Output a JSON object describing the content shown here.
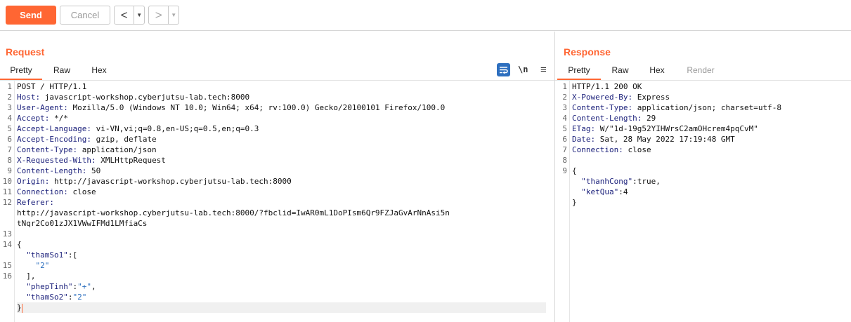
{
  "toolbar": {
    "send_label": "Send",
    "cancel_label": "Cancel",
    "back_glyph": "<",
    "forward_glyph": ">",
    "dropdown_glyph": "▼"
  },
  "request": {
    "title": "Request",
    "tabs": [
      "Pretty",
      "Raw",
      "Hex"
    ],
    "active_tab": "Pretty",
    "newline_label": "\\n",
    "lines": [
      {
        "n": "1",
        "name": "",
        "value": "POST / HTTP/1.1"
      },
      {
        "n": "2",
        "name": "Host:",
        "value": " javascript-workshop.cyberjutsu-lab.tech:8000"
      },
      {
        "n": "3",
        "name": "User-Agent:",
        "value": " Mozilla/5.0 (Windows NT 10.0; Win64; x64; rv:100.0) Gecko/20100101 Firefox/100.0"
      },
      {
        "n": "4",
        "name": "Accept:",
        "value": " */*"
      },
      {
        "n": "5",
        "name": "Accept-Language:",
        "value": " vi-VN,vi;q=0.8,en-US;q=0.5,en;q=0.3"
      },
      {
        "n": "6",
        "name": "Accept-Encoding:",
        "value": " gzip, deflate"
      },
      {
        "n": "7",
        "name": "Content-Type:",
        "value": " application/json"
      },
      {
        "n": "8",
        "name": "X-Requested-With:",
        "value": " XMLHttpRequest"
      },
      {
        "n": "9",
        "name": "Content-Length:",
        "value": " 50"
      },
      {
        "n": "10",
        "name": "Origin:",
        "value": " http://javascript-workshop.cyberjutsu-lab.tech:8000"
      },
      {
        "n": "11",
        "name": "Connection:",
        "value": " close"
      },
      {
        "n": "12",
        "name": "Referer:",
        "value": ""
      },
      {
        "n": "",
        "name": "",
        "value": "http://javascript-workshop.cyberjutsu-lab.tech:8000/?fbclid=IwAR0mL1DoPIsm6Qr9FZJaGvArNnAsi5n"
      },
      {
        "n": "",
        "name": "",
        "value": "tNqr2Co01zJX1VWwIFMd1LMfiaCs"
      },
      {
        "n": "13",
        "name": "",
        "value": ""
      },
      {
        "n": "14",
        "name": "",
        "value": "{"
      },
      {
        "n": "",
        "name": "",
        "key": "\"thamSo1\"",
        "value": ":["
      },
      {
        "n": "15",
        "name": "",
        "str": "\"2\"",
        "indent": "    ",
        "value": ""
      },
      {
        "n": "16",
        "name": "",
        "value": "  ],"
      },
      {
        "n": "",
        "name": "",
        "key": "\"phepTinh\"",
        "value": ":",
        "str": "\"+\"",
        "tail": ","
      },
      {
        "n": "",
        "name": "",
        "key": "\"thamSo2\"",
        "value": ":",
        "str": "\"2\"",
        "tail": ""
      },
      {
        "n": "",
        "name": "",
        "value": "}"
      }
    ]
  },
  "response": {
    "title": "Response",
    "tabs": [
      "Pretty",
      "Raw",
      "Hex",
      "Render"
    ],
    "active_tab": "Pretty",
    "lines": [
      {
        "n": "1",
        "name": "",
        "value": "HTTP/1.1 200 OK"
      },
      {
        "n": "2",
        "name": "X-Powered-By:",
        "value": " Express"
      },
      {
        "n": "3",
        "name": "Content-Type:",
        "value": " application/json; charset=utf-8"
      },
      {
        "n": "4",
        "name": "Content-Length:",
        "value": " 29"
      },
      {
        "n": "5",
        "name": "ETag:",
        "value": " W/\"1d-19g52YIHWrsC2amOHcrem4pqCvM\""
      },
      {
        "n": "6",
        "name": "Date:",
        "value": " Sat, 28 May 2022 17:19:48 GMT"
      },
      {
        "n": "7",
        "name": "Connection:",
        "value": " close"
      },
      {
        "n": "8",
        "name": "",
        "value": ""
      },
      {
        "n": "9",
        "name": "",
        "value": "{"
      },
      {
        "n": "",
        "name": "",
        "key": "\"thanhCong\"",
        "value": ":true,"
      },
      {
        "n": "",
        "name": "",
        "key": "\"ketQua\"",
        "value": ":4"
      },
      {
        "n": "",
        "name": "",
        "value": "}"
      }
    ]
  },
  "colors": {
    "accent": "#ff6633",
    "header_name": "#1a1f7a",
    "json_string": "#2d6fbf",
    "wrap_icon_bg": "#2d6fbf"
  }
}
